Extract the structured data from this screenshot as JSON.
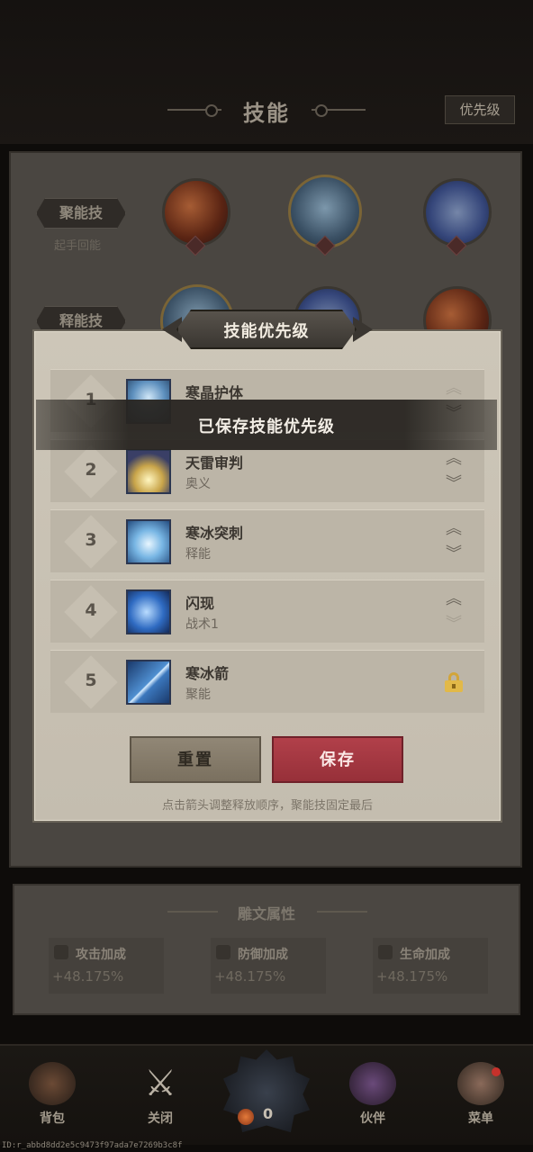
{
  "header": {
    "title": "技能",
    "priority_button": "优先级"
  },
  "skill_rows": [
    {
      "label": "聚能技",
      "sub": "起手回能"
    },
    {
      "label": "释能技",
      "sub": ""
    }
  ],
  "modal": {
    "title": "技能优先级",
    "toast": "已保存技能优先级",
    "skills": [
      {
        "num": "1",
        "name": "寒晶护体",
        "type": "",
        "icon": "frost-shield-icon",
        "up": "︽",
        "down": "︾",
        "locked": false
      },
      {
        "num": "2",
        "name": "天雷审判",
        "type": "奥义",
        "icon": "thunder-judgment-icon",
        "up": "︽",
        "down": "︾",
        "locked": false
      },
      {
        "num": "3",
        "name": "寒冰突刺",
        "type": "释能",
        "icon": "ice-spike-icon",
        "up": "︽",
        "down": "︾",
        "locked": false
      },
      {
        "num": "4",
        "name": "闪现",
        "type": "战术1",
        "icon": "flash-dash-icon",
        "up": "︽",
        "down": "︾",
        "locked": false
      },
      {
        "num": "5",
        "name": "寒冰箭",
        "type": "聚能",
        "icon": "ice-arrow-icon",
        "locked": true
      }
    ],
    "reset_button": "重置",
    "save_button": "保存",
    "hint": "点击箭头调整释放顺序，聚能技固定最后"
  },
  "attributes": {
    "title": "雕文属性",
    "items": [
      {
        "name": "攻击加成",
        "value": "+48.175%",
        "icon": "sword-icon"
      },
      {
        "name": "防御加成",
        "value": "+48.175%",
        "icon": "shield-icon"
      },
      {
        "name": "生命加成",
        "value": "+48.175%",
        "icon": "heart-icon"
      }
    ]
  },
  "nav": {
    "bag": "背包",
    "close": "关闭",
    "center_count": "0",
    "partner": "伙伴",
    "menu": "菜单"
  },
  "footer_id": "ID:r_abbd8dd2e5c9473f97ada7e7269b3c8f",
  "colors": {
    "save": "#a5363f",
    "reset": "#857b6a",
    "panel": "#c9c2b4",
    "lock": "#e2b948"
  }
}
